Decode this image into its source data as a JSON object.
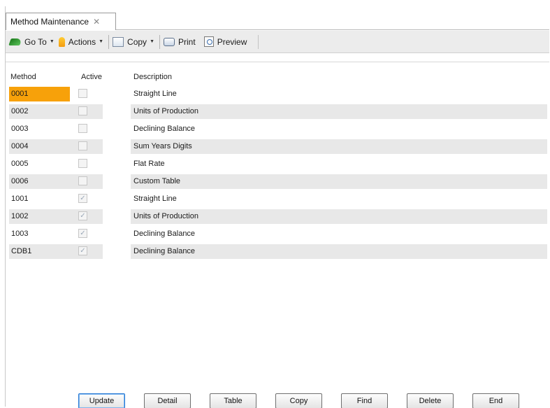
{
  "tab": {
    "title": "Method Maintenance",
    "close_glyph": "✕"
  },
  "toolbar": {
    "goto": "Go To",
    "actions": "Actions",
    "copy": "Copy",
    "print": "Print",
    "preview": "Preview",
    "dropdown_glyph": "▼"
  },
  "columns": {
    "method": "Method",
    "active": "Active",
    "description": "Description"
  },
  "rows": [
    {
      "method": "0001",
      "active": false,
      "description": "Straight Line"
    },
    {
      "method": "0002",
      "active": false,
      "description": "Units of Production"
    },
    {
      "method": "0003",
      "active": false,
      "description": "Declining Balance"
    },
    {
      "method": "0004",
      "active": false,
      "description": "Sum Years Digits"
    },
    {
      "method": "0005",
      "active": false,
      "description": "Flat Rate"
    },
    {
      "method": "0006",
      "active": false,
      "description": "Custom Table"
    },
    {
      "method": "1001",
      "active": true,
      "description": "Straight Line"
    },
    {
      "method": "1002",
      "active": true,
      "description": "Units of Production"
    },
    {
      "method": "1003",
      "active": true,
      "description": "Declining Balance"
    },
    {
      "method": "CDB1",
      "active": true,
      "description": "Declining Balance"
    }
  ],
  "selected_row": 0,
  "colors": {
    "selection": "#f7a10a",
    "alt_row": "#e8e8e8",
    "default_button_border": "#2a7bd5"
  },
  "buttons": {
    "update": "Update",
    "detail": "Detail",
    "table": "Table",
    "copy": "Copy",
    "find": "Find",
    "delete": "Delete",
    "end": "End"
  }
}
